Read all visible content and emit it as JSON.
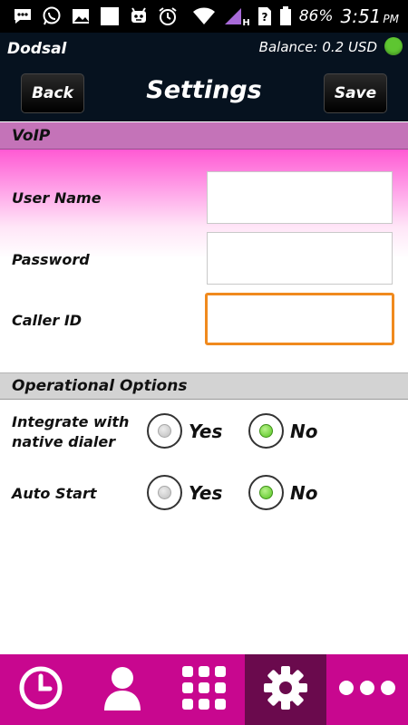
{
  "status_bar": {
    "battery_percent": "86%",
    "time": "3:51",
    "ampm": "PM",
    "network_type": "H",
    "icons": [
      "messages-icon",
      "whatsapp-icon",
      "gallery-icon",
      "blank-app-icon",
      "robot-icon",
      "alarm-icon",
      "wifi-icon",
      "signal-icon",
      "sim-unknown-icon",
      "battery-icon"
    ]
  },
  "header": {
    "brand": "Dodsal",
    "balance": "Balance: 0.2 USD",
    "title": "Settings",
    "back_label": "Back",
    "save_label": "Save",
    "online_color": "#5ec631"
  },
  "voip": {
    "section_title": "VoIP",
    "fields": [
      {
        "label": "User Name",
        "value": "",
        "placeholder": ""
      },
      {
        "label": "Password",
        "value": "",
        "placeholder": ""
      },
      {
        "label": "Caller ID",
        "value": "",
        "placeholder": ""
      }
    ]
  },
  "options": {
    "section_title": "Operational Options",
    "rows": [
      {
        "label_line1": "Integrate with",
        "label_line2": "native dialer",
        "yes_label": "Yes",
        "no_label": "No",
        "selected": "No"
      },
      {
        "label": "Auto Start",
        "yes_label": "Yes",
        "no_label": "No",
        "selected": "No"
      }
    ]
  },
  "bottom_nav": {
    "items": [
      {
        "name": "history",
        "icon": "clock-icon",
        "active": false
      },
      {
        "name": "contacts",
        "icon": "person-icon",
        "active": false
      },
      {
        "name": "dialpad",
        "icon": "dialpad-grid-icon",
        "active": false
      },
      {
        "name": "settings",
        "icon": "gear-icon",
        "active": true
      },
      {
        "name": "more",
        "icon": "more-dots-icon",
        "active": false
      }
    ]
  },
  "colors": {
    "accent_magenta": "#c8078f",
    "active_nav": "#6a0a4d",
    "focus_orange": "#f08a1e"
  }
}
